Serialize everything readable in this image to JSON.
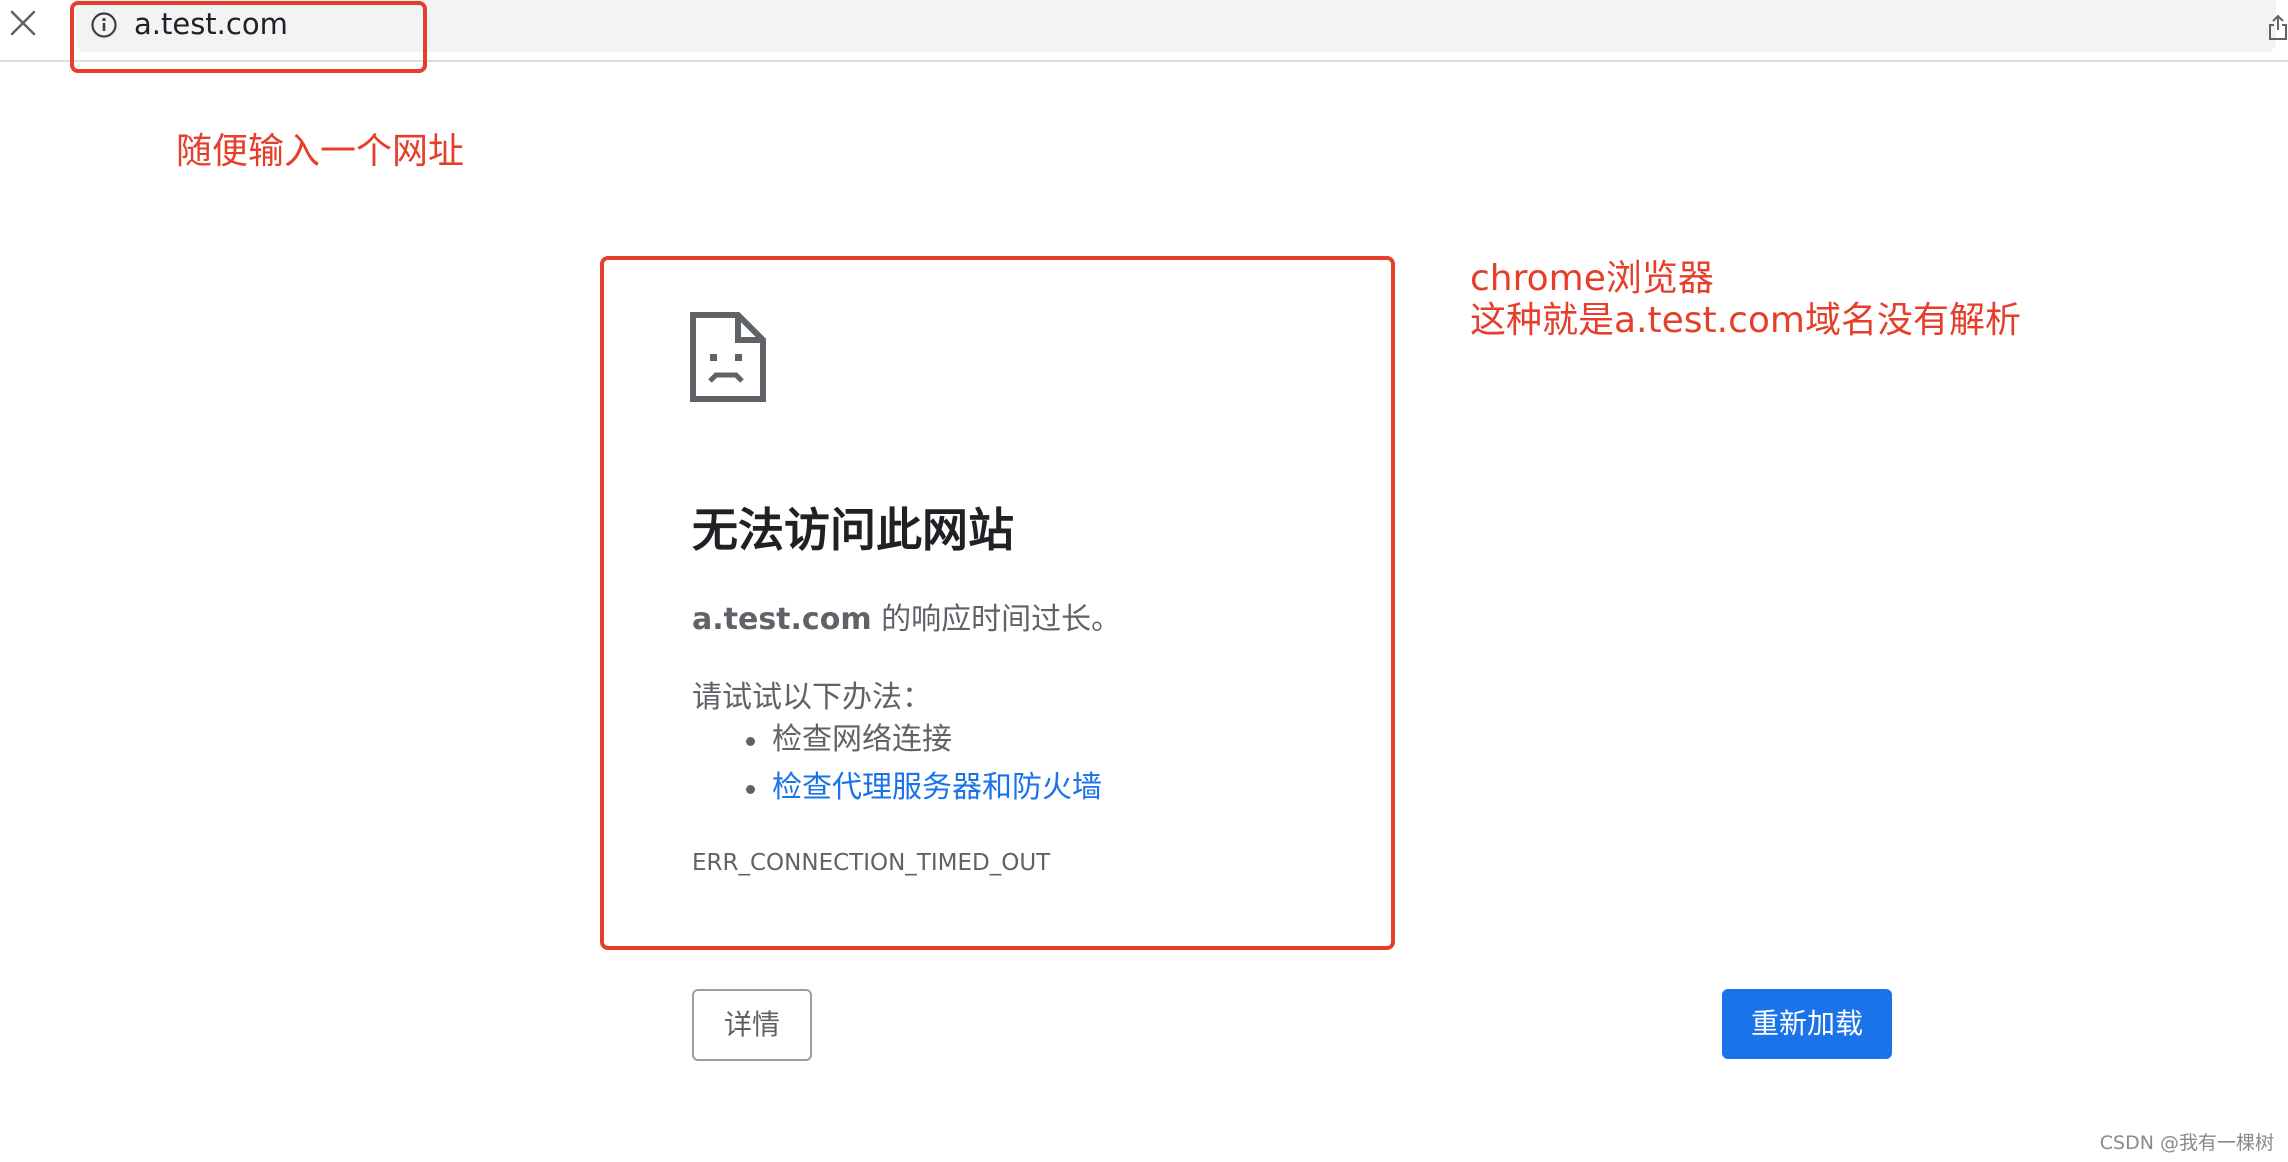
{
  "browser": {
    "url": "a.test.com",
    "close_icon": "close-icon",
    "info_icon": "info-icon",
    "share_icon": "share-icon"
  },
  "annotations": {
    "url_note": "随便输入一个网址",
    "chrome_note_line1": "chrome浏览器",
    "chrome_note_line2": "这种就是a.test.com域名没有解析",
    "color": "#e53e2b"
  },
  "error_page": {
    "icon": "sad-page-icon",
    "title": "无法访问此网站",
    "host": "a.test.com",
    "description": " 的响应时间过长。",
    "suggest_heading": "请试试以下办法：",
    "suggestions": [
      {
        "label": "检查网络连接",
        "is_link": false
      },
      {
        "label": "检查代理服务器和防火墙",
        "is_link": true
      }
    ],
    "error_code": "ERR_CONNECTION_TIMED_OUT"
  },
  "buttons": {
    "details_label": "详情",
    "reload_label": "重新加载"
  },
  "colors": {
    "link": "#1a73e8",
    "primary_button": "#1a73e8",
    "text_secondary": "#5f6368"
  },
  "watermark": "CSDN @我有一棵树"
}
